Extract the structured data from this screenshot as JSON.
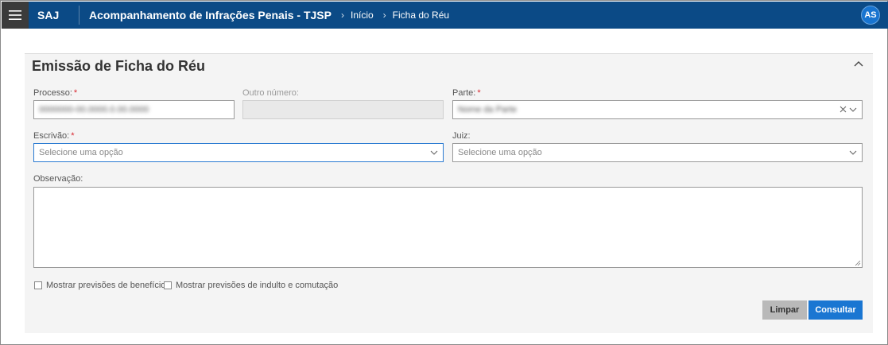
{
  "topbar": {
    "brand": "SAJ",
    "app_title": "Acompanhamento de Infrações Penais - TJSP",
    "breadcrumb": [
      "Início",
      "Ficha do Réu"
    ],
    "user_initials": "AS",
    "colors": {
      "bar": "#0b4a86",
      "menu_button": "#3b3b3b",
      "avatar": "#1874d0"
    }
  },
  "form": {
    "title": "Emissão de Ficha do Réu",
    "fields": {
      "processo": {
        "label": "Processo:",
        "required_mark": "*",
        "value": "0000000-00.0000.0.00.0000"
      },
      "outro_numero": {
        "label": "Outro número:",
        "value": ""
      },
      "parte": {
        "label": "Parte:",
        "required_mark": "*",
        "value": "Nome da Parte"
      },
      "escrivao": {
        "label": "Escrivão:",
        "required_mark": "*",
        "placeholder": "Selecione uma opção"
      },
      "juiz": {
        "label": "Juiz:",
        "placeholder": "Selecione uma opção"
      },
      "observacao": {
        "label": "Observação:",
        "value": ""
      }
    },
    "checkboxes": {
      "beneficios": {
        "label": "Mostrar previsões de benefícios",
        "checked": false
      },
      "indulto": {
        "label": "Mostrar previsões de indulto e comutação",
        "checked": false
      }
    },
    "buttons": {
      "limpar": "Limpar",
      "consultar": "Consultar"
    },
    "colors": {
      "primary": "#1a76d2",
      "secondary": "#b9b9b9",
      "required": "#d8272f"
    }
  }
}
